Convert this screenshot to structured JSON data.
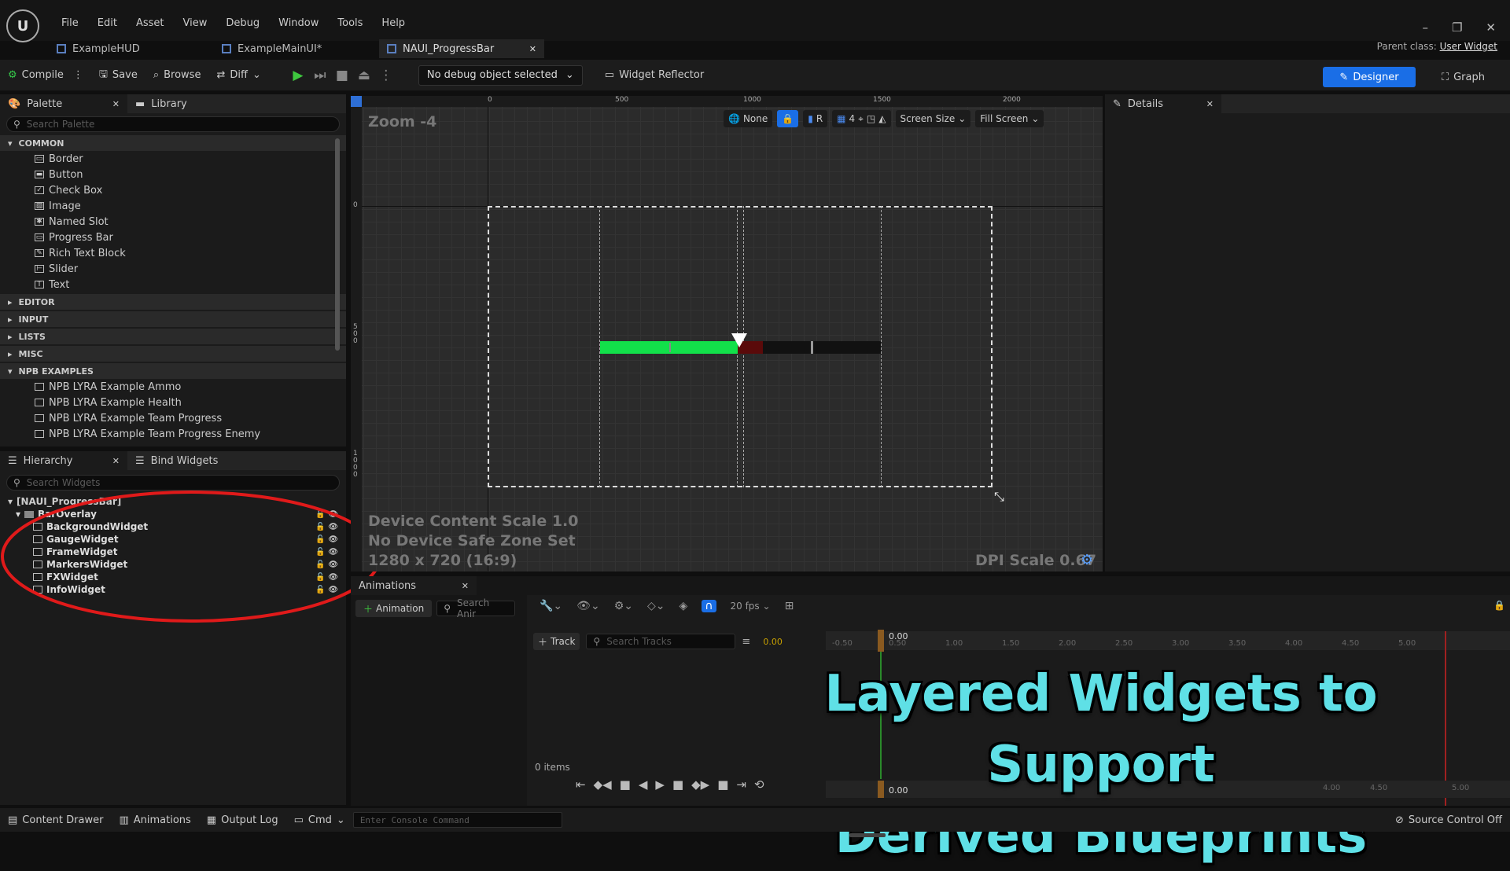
{
  "menu": [
    "File",
    "Edit",
    "Asset",
    "View",
    "Debug",
    "Window",
    "Tools",
    "Help"
  ],
  "tabs": [
    {
      "label": "ExampleHUD"
    },
    {
      "label": "ExampleMainUI*"
    },
    {
      "label": "NAUI_ProgressBar"
    }
  ],
  "parent_class": {
    "label": "Parent class:",
    "value": "User Widget"
  },
  "toolbar": {
    "compile": "Compile",
    "save": "Save",
    "browse": "Browse",
    "diff": "Diff",
    "debug_object": "No debug object selected",
    "widget_reflector": "Widget Reflector",
    "designer": "Designer",
    "graph": "Graph"
  },
  "palette": {
    "tab": "Palette",
    "library_tab": "Library",
    "search_placeholder": "Search Palette",
    "common": "COMMON",
    "items": [
      {
        "label": "Border",
        "icon": "▭"
      },
      {
        "label": "Button",
        "icon": "▬"
      },
      {
        "label": "Check Box",
        "icon": "✓"
      },
      {
        "label": "Image",
        "icon": "▧"
      },
      {
        "label": "Named Slot",
        "icon": "✱"
      },
      {
        "label": "Progress Bar",
        "icon": "▭"
      },
      {
        "label": "Rich Text Block",
        "icon": "✎"
      },
      {
        "label": "Slider",
        "icon": "⊢"
      },
      {
        "label": "Text",
        "icon": "T"
      }
    ],
    "categories": [
      "EDITOR",
      "INPUT",
      "LISTS",
      "MISC"
    ],
    "npb": "NPB EXAMPLES",
    "npb_items": [
      "NPB LYRA Example Ammo",
      "NPB LYRA Example Health",
      "NPB LYRA Example Team Progress",
      "NPB LYRA Example Team Progress Enemy"
    ]
  },
  "hierarchy": {
    "tab": "Hierarchy",
    "bind_tab": "Bind Widgets",
    "search_placeholder": "Search Widgets",
    "root": "[NAUI_ProgressBar]",
    "overlay": "BarOverlay",
    "children": [
      "BackgroundWidget",
      "GaugeWidget",
      "FrameWidget",
      "MarkersWidget",
      "FXWidget",
      "InfoWidget"
    ]
  },
  "viewport": {
    "zoom": "Zoom -4",
    "ruler_top": [
      "0",
      "500",
      "1000",
      "1500",
      "2000"
    ],
    "ruler_left": [
      "0",
      "500",
      "1000"
    ],
    "tools": {
      "none": "None",
      "r": "R",
      "grid": "4",
      "screen_size": "Screen Size",
      "fill_screen": "Fill Screen"
    },
    "device_content_scale": "Device Content Scale 1.0",
    "safe_zone": "No Device Safe Zone Set",
    "resolution": "1280 x 720 (16:9)",
    "dpi_scale": "DPI Scale 0.67",
    "progress_fill": 0.49,
    "progress_damage": 0.09
  },
  "details": {
    "tab": "Details"
  },
  "animations": {
    "tab": "Animations",
    "add_button": "Animation",
    "search_placeholder": "Search Anir",
    "fps": "20 fps",
    "track_button": "Track",
    "search_tracks": "Search Tracks",
    "time_value": "0.00",
    "items_count": "0 items",
    "timeline_current": "0.00",
    "timeline_bottom": "0.00",
    "timeline_ticks": [
      "-0.50",
      "0.50",
      "1.00",
      "1.50",
      "2.00",
      "2.50",
      "3.00",
      "3.50",
      "4.00",
      "4.50",
      "5.00"
    ],
    "bottom_ticks": [
      "4.00",
      "4.50",
      "5.00"
    ]
  },
  "bottom_bar": {
    "content_drawer": "Content Drawer",
    "animations": "Animations",
    "output_log": "Output Log",
    "cmd": "Cmd",
    "console_placeholder": "Enter Console Command",
    "source_control": "Source Control Off"
  },
  "overlay_text": {
    "line1": "Layered Widgets to Support",
    "line2": "Derived Blueprints"
  },
  "colors": {
    "accent": "#1a6ee6",
    "progress_green": "#12e04a",
    "annotation_red": "#e01a1a",
    "title_cyan": "#5fe0e6"
  }
}
